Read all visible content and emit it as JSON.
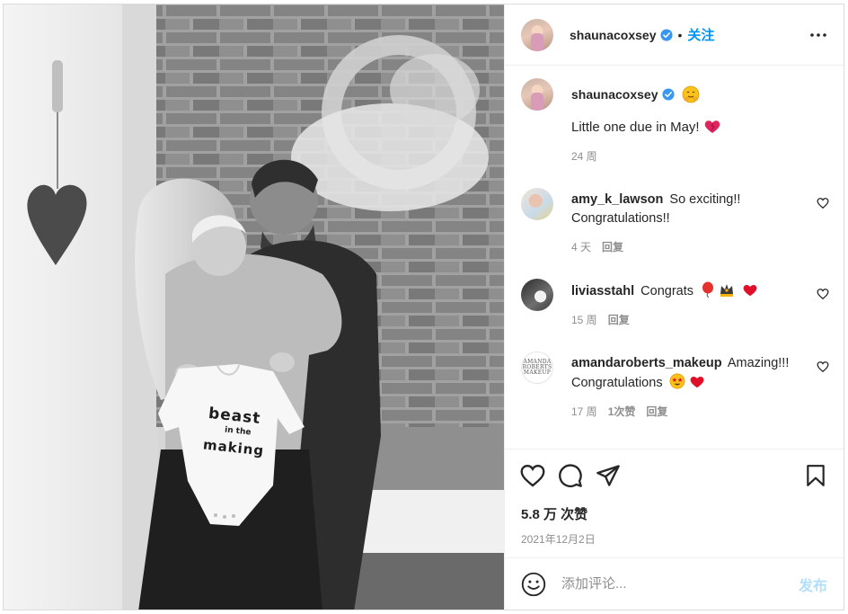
{
  "post": {
    "author": "shaunacoxsey",
    "follow_label": "关注",
    "dot": "•",
    "photo_onesie_text": [
      "beast",
      "in the",
      "making"
    ]
  },
  "caption": {
    "username": "shaunacoxsey",
    "text": "Little one due in May!",
    "time": "24 周"
  },
  "comments": [
    {
      "username": "amy_k_lawson",
      "text": "So exciting!! Congratulations!!",
      "time": "4 天",
      "reply": "回复"
    },
    {
      "username": "liviasstahl",
      "text": "Congrats",
      "time": "15 周",
      "reply": "回复"
    },
    {
      "username": "amandaroberts_makeup",
      "text": "Amazing!!! Congratulations",
      "time": "17 周",
      "likes": "1次赞",
      "reply": "回复",
      "avatar_text": "AMANDA ROBERTS MAKEUP"
    }
  ],
  "likes_count": "5.8 万 次赞",
  "date": "2021年12月2日",
  "add_comment": {
    "placeholder": "添加评论...",
    "post_label": "发布"
  },
  "colors": {
    "accent": "#0095f6",
    "verified": "#3897f0",
    "muted": "#8e8e8e",
    "post_disabled": "#b2dffc"
  },
  "icons": [
    "verified-badge-icon",
    "more-options-icon",
    "heart-icon",
    "comment-icon",
    "share-icon",
    "bookmark-icon",
    "emoji-smile-icon"
  ]
}
